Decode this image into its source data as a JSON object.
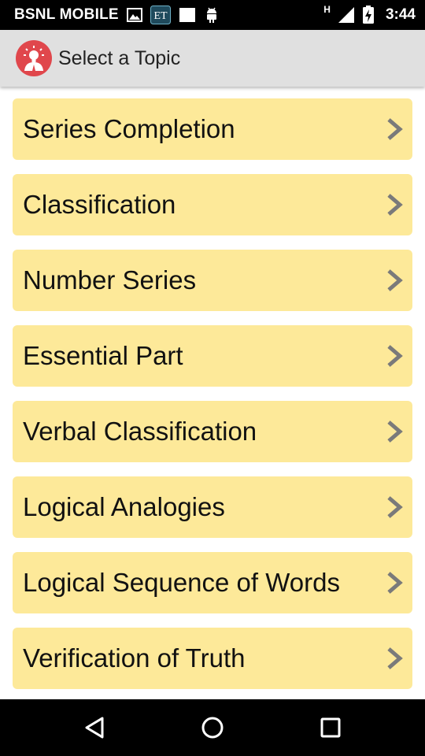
{
  "status_bar": {
    "carrier": "BSNL MOBILE",
    "network_type": "H",
    "time": "3:44",
    "icons": [
      "image-icon",
      "et-app-icon",
      "square-notification-icon",
      "android-icon",
      "signal-icon",
      "battery-charging-icon"
    ],
    "et_badge": "ET"
  },
  "app_bar": {
    "title": "Select a Topic",
    "logo_icon": "lightbulb-person-icon"
  },
  "topics": [
    {
      "label": "Series Completion"
    },
    {
      "label": "Classification"
    },
    {
      "label": "Number Series"
    },
    {
      "label": "Essential Part"
    },
    {
      "label": "Verbal Classification"
    },
    {
      "label": "Logical Analogies"
    },
    {
      "label": "Logical Sequence of Words"
    },
    {
      "label": "Verification of Truth"
    }
  ],
  "nav_bar": {
    "icons": [
      "back-icon",
      "home-icon",
      "recents-icon"
    ]
  },
  "colors": {
    "status_bar": "#000000",
    "app_bar": "#e0e0e0",
    "item_background": "#fde999",
    "chevron": "#7a7a7a",
    "logo": "#e0474c"
  }
}
